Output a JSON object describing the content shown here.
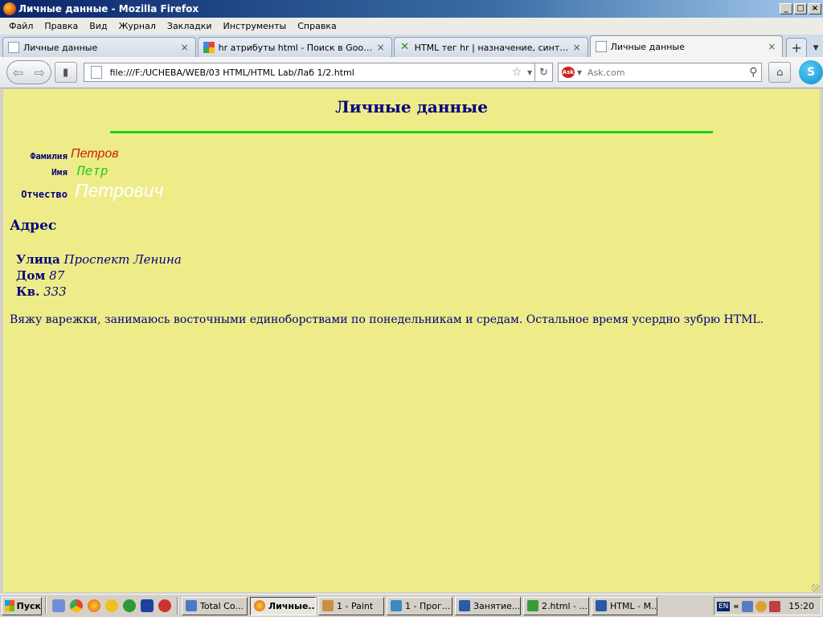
{
  "window": {
    "title": "Личные данные - Mozilla Firefox"
  },
  "menu": [
    "Файл",
    "Правка",
    "Вид",
    "Журнал",
    "Закладки",
    "Инструменты",
    "Справка"
  ],
  "tabs": [
    {
      "label": "Личные данные",
      "icon": "page-icon",
      "active": false
    },
    {
      "label": "hr атрибуты html - Поиск в Google",
      "icon": "google-icon",
      "active": false
    },
    {
      "label": "HTML тег hr | назначение, синтаксис,...",
      "icon": "site-icon",
      "active": false
    },
    {
      "label": "Личные данные",
      "icon": "page-icon",
      "active": true
    }
  ],
  "toolbar": {
    "url": "file:///F:/UCHEBA/WEB/03 HTML/HTML Lab/Лаб 1/2.html",
    "search_placeholder": "Ask.com"
  },
  "page": {
    "title": "Личные данные",
    "rule_color": "#1ad31a",
    "fields": [
      {
        "label": "Фамилия",
        "value": "Петров",
        "color": "#cc2200"
      },
      {
        "label": "Имя",
        "value": "Петр",
        "color": "#22cc22"
      },
      {
        "label": "Отчество",
        "value": "Петрович",
        "color": "#ffffff"
      }
    ],
    "address_heading": "Адрес",
    "address": [
      {
        "label": "Улица",
        "value": "Проспект Ленина"
      },
      {
        "label": "Дом",
        "value": "87"
      },
      {
        "label": "Кв.",
        "value": "333"
      }
    ],
    "about": "Вяжу варежки, занимаюсь восточными единоборствами по понедельникам и средам. Остальное время усердно зубрю HTML."
  },
  "taskbar": {
    "start_label": "Пуск",
    "items": [
      {
        "label": "Total Co...",
        "active": false
      },
      {
        "label": "Личные...",
        "active": true
      },
      {
        "label": "1 - Paint",
        "active": false
      },
      {
        "label": "1 - Прог...",
        "active": false
      },
      {
        "label": "Занятие...",
        "active": false
      },
      {
        "label": "2.html - ...",
        "active": false
      },
      {
        "label": "HTML - M...",
        "active": false
      }
    ],
    "lang": "EN",
    "clock": "15:20"
  },
  "colors": {
    "page_bg": "#eeec88",
    "text": "#000080"
  }
}
